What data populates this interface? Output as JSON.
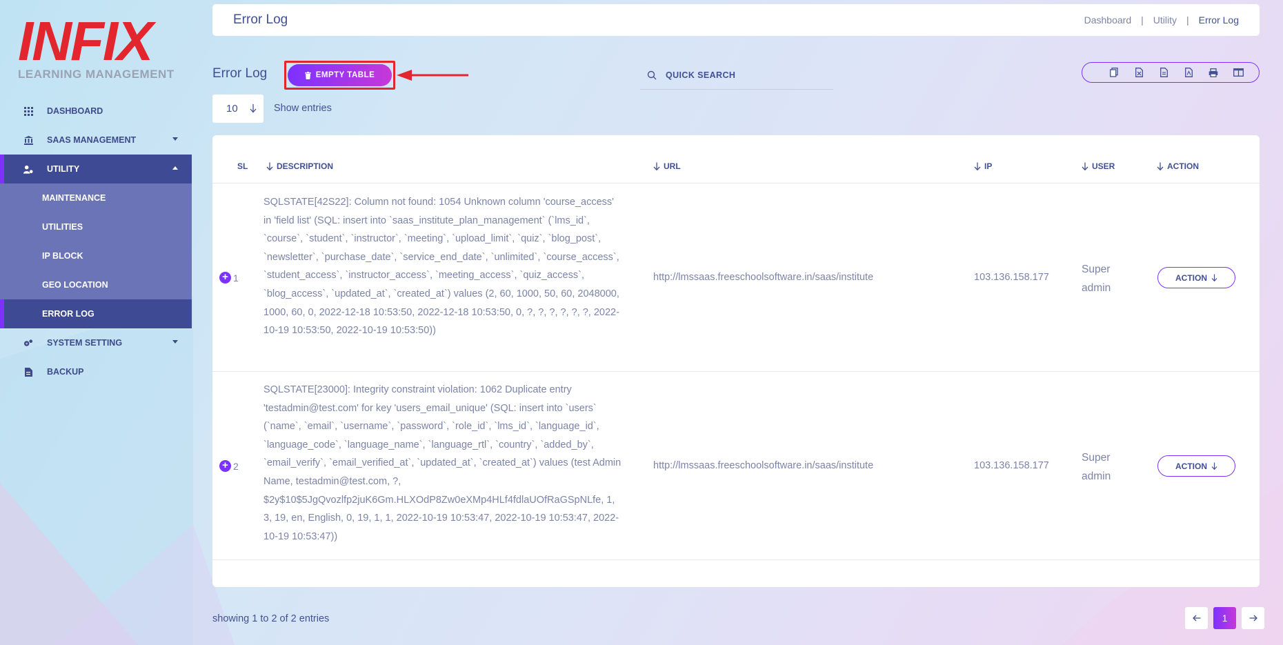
{
  "brand": {
    "logo_text": "INFIX",
    "logo_subtitle": "LEARNING MANAGEMENT"
  },
  "sidebar": {
    "items": [
      {
        "label": "DASHBOARD",
        "icon": "grid-icon"
      },
      {
        "label": "SAAS MANAGEMENT",
        "icon": "bank-icon"
      },
      {
        "label": "UTILITY",
        "icon": "user-gear-icon"
      },
      {
        "label": "SYSTEM SETTING",
        "icon": "gears-icon"
      },
      {
        "label": "BACKUP",
        "icon": "file-icon"
      }
    ],
    "utility_sub": [
      {
        "label": "MAINTENANCE"
      },
      {
        "label": "UTILITIES"
      },
      {
        "label": "IP BLOCK"
      },
      {
        "label": "GEO LOCATION"
      },
      {
        "label": "ERROR LOG"
      }
    ]
  },
  "header": {
    "title": "Error Log",
    "breadcrumb": [
      "Dashboard",
      "Utility",
      "Error Log"
    ],
    "separator": "|"
  },
  "toolbar": {
    "section_title": "Error Log",
    "empty_button": "EMPTY TABLE",
    "search_placeholder": "QUICK SEARCH",
    "export_icons": [
      "copy-icon",
      "excel-icon",
      "csv-icon",
      "pdf-icon",
      "print-icon",
      "columns-icon"
    ],
    "entries_value": "10",
    "entries_label": "Show entries"
  },
  "table": {
    "headers": {
      "sl": "SL",
      "description": "DESCRIPTION",
      "url": "URL",
      "ip": "IP",
      "user": "USER",
      "action": "ACTION"
    },
    "rows": [
      {
        "sl": "1",
        "description": "SQLSTATE[42S22]: Column not found: 1054 Unknown column 'course_access' in 'field list' (SQL: insert into `saas_institute_plan_management` (`lms_id`, `course`, `student`, `instructor`, `meeting`, `upload_limit`, `quiz`, `blog_post`, `newsletter`, `purchase_date`, `service_end_date`, `unlimited`, `course_access`, `student_access`, `instructor_access`, `meeting_access`, `quiz_access`, `blog_access`, `updated_at`, `created_at`) values (2, 60, 1000, 50, 60, 2048000, 1000, 60, 0, 2022-12-18 10:53:50, 2022-12-18 10:53:50, 0, ?, ?, ?, ?, ?, ?, 2022-10-19 10:53:50, 2022-10-19 10:53:50))",
        "url": "http://lmssaas.freeschoolsoftware.in/saas/institute",
        "ip": "103.136.158.177",
        "user": "Super admin",
        "action": "ACTION"
      },
      {
        "sl": "2",
        "description": "SQLSTATE[23000]: Integrity constraint violation: 1062 Duplicate entry 'testadmin@test.com' for key 'users_email_unique' (SQL: insert into `users` (`name`, `email`, `username`, `password`, `role_id`, `lms_id`, `language_id`, `language_code`, `language_name`, `language_rtl`, `country`, `added_by`, `email_verify`, `email_verified_at`, `updated_at`, `created_at`) values (test Admin Name, testadmin@test.com, ?, $2y$10$5JgQvozlfp2juK6Gm.HLXOdP8Zw0eXMp4HLf4fdlaUOfRaGSpNLfe, 1, 3, 19, en, English, 0, 19, 1, 1, 2022-10-19 10:53:47, 2022-10-19 10:53:47, 2022-10-19 10:53:47))",
        "url": "http://lmssaas.freeschoolsoftware.in/saas/institute",
        "ip": "103.136.158.177",
        "user": "Super admin",
        "action": "ACTION"
      }
    ]
  },
  "footer": {
    "showing": "showing 1 to 2 of 2 entries",
    "current_page": "1"
  },
  "colors": {
    "accent": "#7c32ff",
    "accent_2": "#c738d8",
    "nav_active": "#3f4a94",
    "highlight": "#e3262d"
  }
}
